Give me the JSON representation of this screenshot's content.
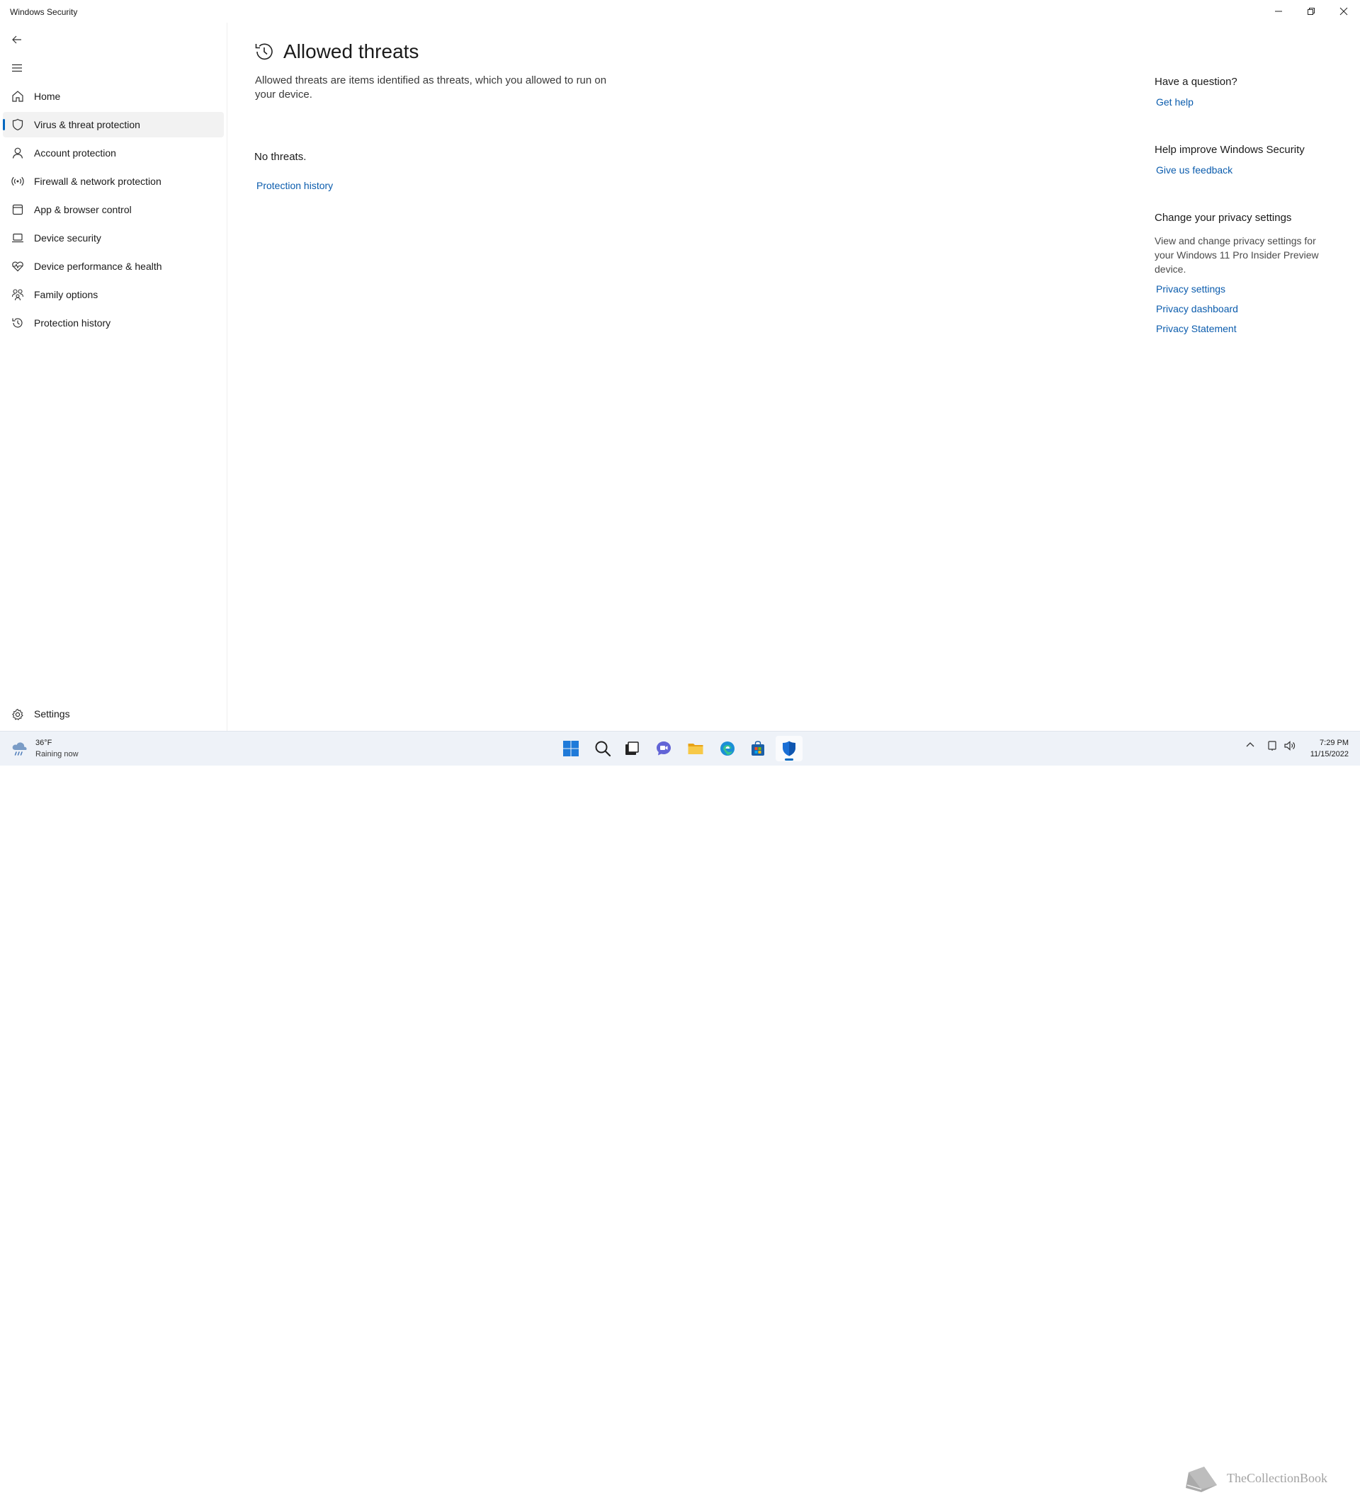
{
  "window": {
    "title": "Windows Security"
  },
  "sidebar": {
    "items": [
      {
        "label": "Home",
        "icon": "home-icon"
      },
      {
        "label": "Virus & threat protection",
        "icon": "shield-icon",
        "active": true
      },
      {
        "label": "Account protection",
        "icon": "person-icon"
      },
      {
        "label": "Firewall & network protection",
        "icon": "wifi-antenna-icon"
      },
      {
        "label": "App & browser control",
        "icon": "app-window-icon"
      },
      {
        "label": "Device security",
        "icon": "laptop-icon"
      },
      {
        "label": "Device performance & health",
        "icon": "heart-pulse-icon"
      },
      {
        "label": "Family options",
        "icon": "family-icon"
      },
      {
        "label": "Protection history",
        "icon": "history-icon"
      }
    ],
    "settings_label": "Settings"
  },
  "main": {
    "title": "Allowed threats",
    "description": "Allowed threats are items identified as threats, which you allowed to run on your device.",
    "status": "No threats.",
    "history_link": "Protection history"
  },
  "right_panel": {
    "question": {
      "heading": "Have a question?",
      "link": "Get help"
    },
    "improve": {
      "heading": "Help improve Windows Security",
      "link": "Give us feedback"
    },
    "privacy": {
      "heading": "Change your privacy settings",
      "text": "View and change privacy settings for your Windows 11 Pro Insider Preview device.",
      "links": [
        "Privacy settings",
        "Privacy dashboard",
        "Privacy Statement"
      ]
    }
  },
  "taskbar": {
    "weather": {
      "temp": "36°F",
      "desc": "Raining now"
    },
    "apps": [
      "start-icon",
      "search-icon",
      "task-view-icon",
      "chat-icon",
      "file-explorer-icon",
      "edge-icon",
      "store-icon",
      "windows-security-icon"
    ],
    "active_app": "windows-security-icon",
    "clock": {
      "time": "7:29 PM",
      "date": "11/15/2022"
    },
    "watermark": "TheCollectionBook"
  },
  "colors": {
    "accent": "#0067c0",
    "link": "#0b5cad",
    "taskbar_bg": "#eef2f8"
  }
}
